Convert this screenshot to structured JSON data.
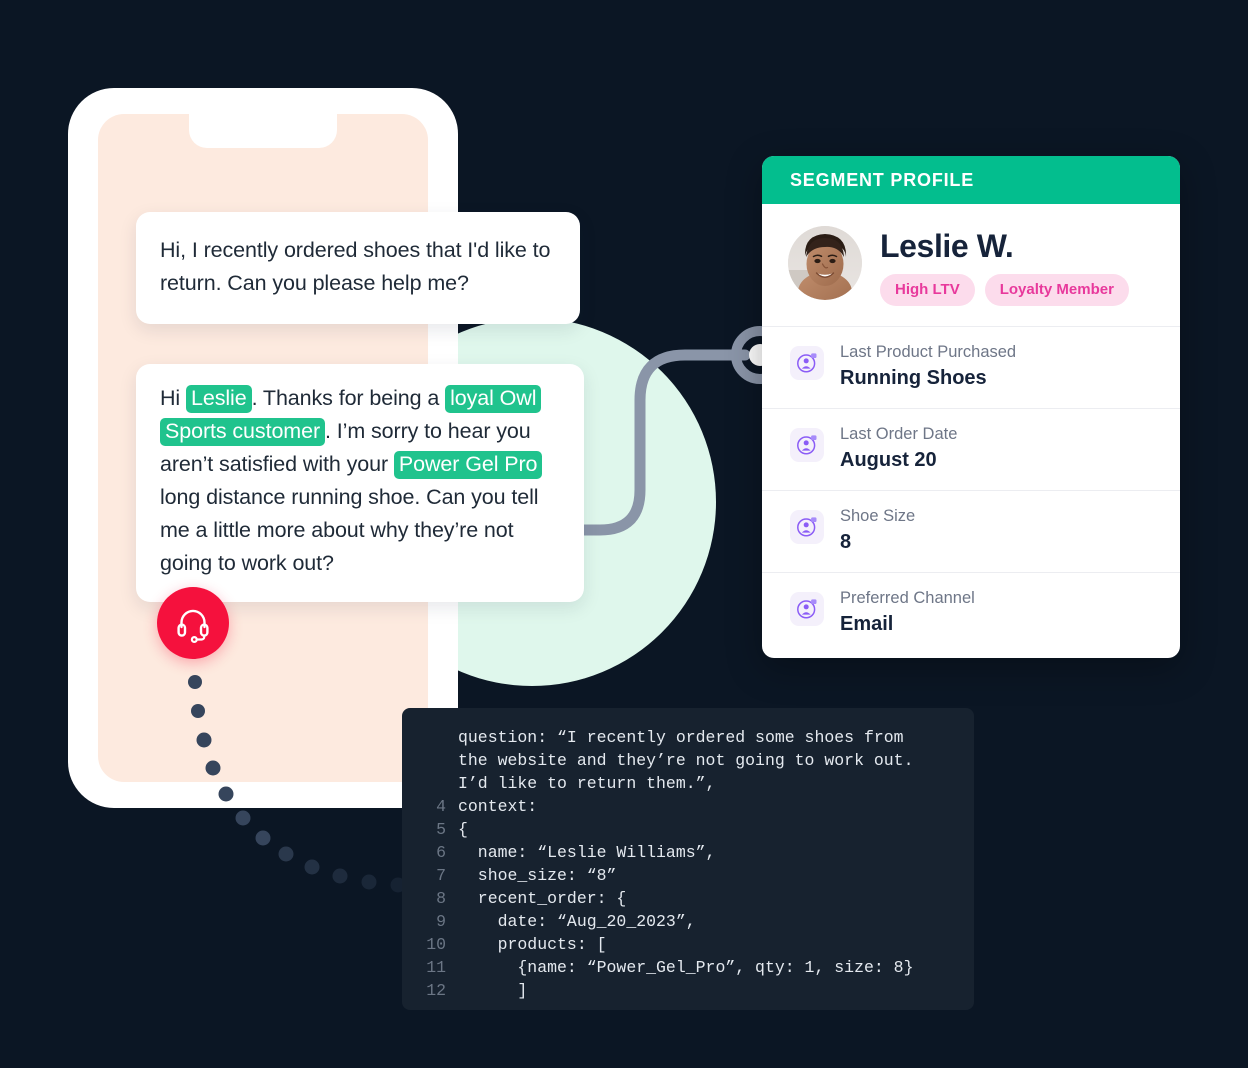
{
  "chat": {
    "customer_message": "Hi, I recently ordered shoes that I'd like to return. Can you please help me?",
    "agent_message_parts": [
      {
        "text": "Hi ",
        "highlight": false
      },
      {
        "text": "Leslie",
        "highlight": true
      },
      {
        "text": ". Thanks for being a ",
        "highlight": false
      },
      {
        "text": "loyal Owl Sports customer",
        "highlight": true
      },
      {
        "text": ". I’m sorry to hear you aren’t satisfied with your ",
        "highlight": false
      },
      {
        "text": "Power Gel Pro",
        "highlight": true
      },
      {
        "text": " long distance running shoe. Can you tell me a little more about why they’re not going to work out?",
        "highlight": false
      }
    ],
    "agent_icon": "headset-icon"
  },
  "profile": {
    "header_title": "SEGMENT PROFILE",
    "name": "Leslie W.",
    "avatar_icon": "customer-avatar",
    "tags": [
      "High LTV",
      "Loyalty Member"
    ],
    "rows": [
      {
        "icon": "customer-profile-icon",
        "label": "Last Product Purchased",
        "value": "Running Shoes"
      },
      {
        "icon": "customer-profile-icon",
        "label": "Last Order Date",
        "value": "August 20"
      },
      {
        "icon": "customer-profile-icon",
        "label": "Shoe Size",
        "value": "8"
      },
      {
        "icon": "customer-profile-icon",
        "label": "Preferred Channel",
        "value": "Email"
      }
    ]
  },
  "code_panel": {
    "lines": [
      {
        "number": "",
        "text": "question: “I recently ordered some shoes from"
      },
      {
        "number": "",
        "text": "the website and they’re not going to work out."
      },
      {
        "number": "",
        "text": "I’d like to return them.”,"
      },
      {
        "number": "4",
        "text": "context:"
      },
      {
        "number": "5",
        "text": "{"
      },
      {
        "number": "6",
        "text": "  name: “Leslie Williams”,"
      },
      {
        "number": "7",
        "text": "  shoe_size: “8”"
      },
      {
        "number": "8",
        "text": "  recent_order: {"
      },
      {
        "number": "9",
        "text": "    date: “Aug_20_2023”,"
      },
      {
        "number": "10",
        "text": "    products: ["
      },
      {
        "number": "11",
        "text": "      {name: “Power_Gel_Pro”, qty: 1, size: 8}"
      },
      {
        "number": "12",
        "text": "      ]"
      }
    ]
  },
  "colors": {
    "brand_green": "#03BE8E",
    "highlight_green": "#20C38D",
    "pill_bg": "#FCDCEC",
    "pill_text": "#E8399C",
    "agent_red": "#F5113D",
    "phone_screen": "#FDEADF",
    "mint": "#DFF7EC",
    "code_bg": "#17222F",
    "page_bg": "#0B1624"
  }
}
